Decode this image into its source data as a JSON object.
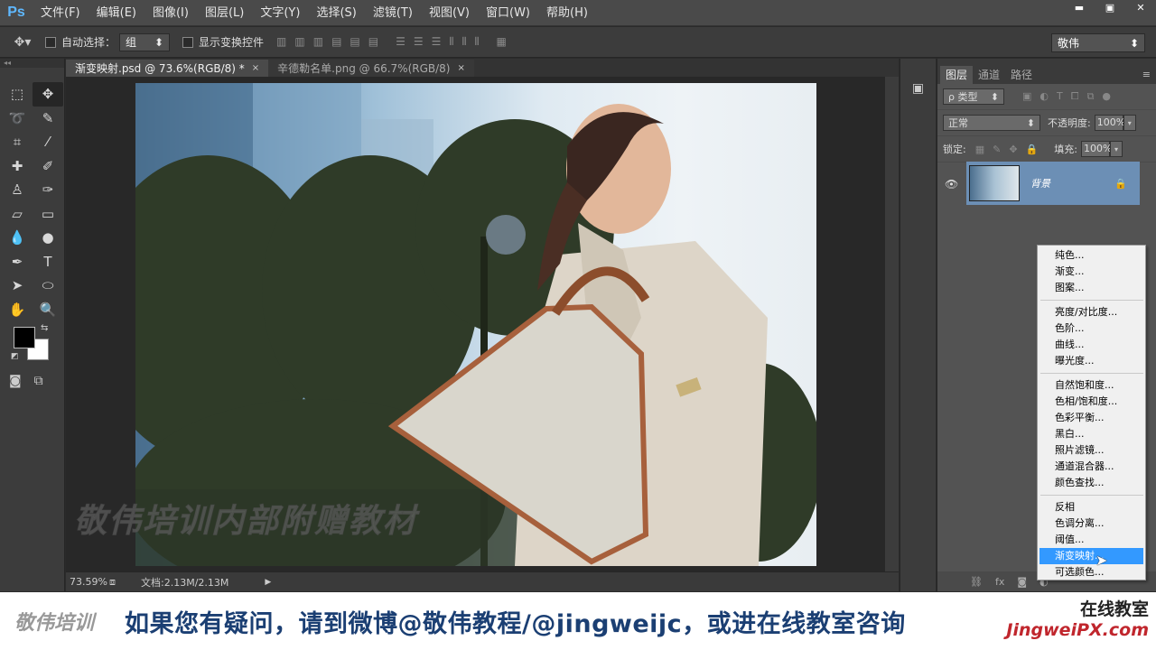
{
  "app": {
    "logo": "Ps"
  },
  "menu": [
    "文件(F)",
    "编辑(E)",
    "图像(I)",
    "图层(L)",
    "文字(Y)",
    "选择(S)",
    "滤镜(T)",
    "视图(V)",
    "窗口(W)",
    "帮助(H)"
  ],
  "window_controls": {
    "minimize": "▬",
    "maximize": "▣",
    "close": "✕"
  },
  "options": {
    "auto_select_label": "自动选择：",
    "auto_select_value": "组",
    "show_transform_label": "显示变换控件",
    "workspace": "敬伟"
  },
  "tabs": [
    {
      "label": "渐变映射.psd @ 73.6%(RGB/8) *",
      "close": "×"
    },
    {
      "label": "辛德勒名单.png @ 66.7%(RGB/8)",
      "close": "×"
    }
  ],
  "status": {
    "zoom": "73.59%",
    "doc": "文档:2.13M/2.13M"
  },
  "layers_panel": {
    "tabs": [
      "图层",
      "通道",
      "路径"
    ],
    "filter_type": "ρ 类型",
    "blend_mode": "正常",
    "opacity_label": "不透明度:",
    "opacity_value": "100%",
    "lock_label": "锁定:",
    "fill_label": "填充:",
    "fill_value": "100%",
    "layer_name": "背景"
  },
  "context_menu": {
    "group1": [
      "纯色...",
      "渐变...",
      "图案..."
    ],
    "group2": [
      "亮度/对比度...",
      "色阶...",
      "曲线...",
      "曝光度..."
    ],
    "group3": [
      "自然饱和度...",
      "色相/饱和度...",
      "色彩平衡...",
      "黑白...",
      "照片滤镜...",
      "通道混合器...",
      "颜色查找..."
    ],
    "group4": [
      "反相",
      "色调分离...",
      "阈值...",
      "渐变映射...",
      "可选颜色..."
    ],
    "highlighted": "渐变映射..."
  },
  "watermark": "敬伟培训内部附赠教材",
  "banner": {
    "logo": "敬伟培训",
    "message": "如果您有疑问，请到微博@敬伟教程/@jingweijc，或进在线教室咨询",
    "right_top": "在线教室",
    "right_bottom": "JingweiPX.com"
  },
  "colors": {
    "menubar": "#4a4a4a",
    "panel": "#535353",
    "selected_layer": "#6c8fb5",
    "menu_highlight": "#3399ff",
    "banner_text": "#1b3f73",
    "banner_url": "#c0262d"
  },
  "icons": [
    "ps-logo",
    "move-tool-icon",
    "marquee-icon",
    "lasso-icon",
    "crop-icon",
    "brush-icon",
    "type-icon",
    "hand-icon",
    "zoom-icon",
    "eye-icon",
    "lock-icon",
    "link-icon",
    "fx-icon",
    "mask-icon",
    "cursor-icon"
  ]
}
